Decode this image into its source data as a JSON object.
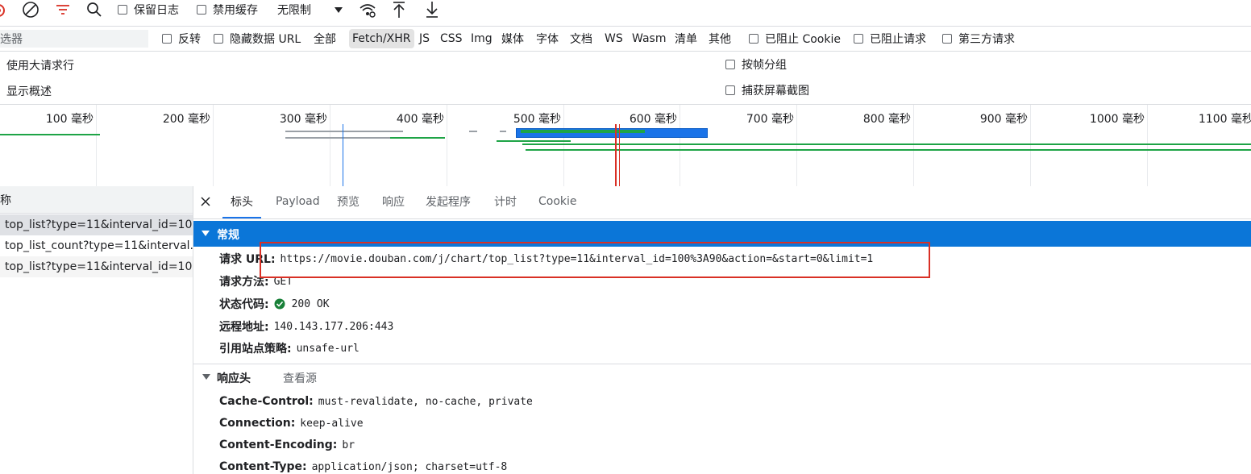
{
  "toolbar": {
    "preserve_log": "保留日志",
    "disable_cache": "禁用缓存",
    "throttle": "无限制"
  },
  "filter": {
    "placeholder": "选器",
    "invert": "反转",
    "hide_data_url": "隐藏数据 URL",
    "types": [
      "全部",
      "Fetch/XHR",
      "JS",
      "CSS",
      "Img",
      "媒体",
      "字体",
      "文档",
      "WS",
      "Wasm",
      "清单",
      "其他"
    ],
    "blocked_cookie": "已阻止 Cookie",
    "blocked_requests": "已阻止请求",
    "third_party": "第三方请求"
  },
  "options": {
    "big_rows": "使用大请求行",
    "show_overview": "显示概述",
    "group_by_frame": "按帧分组",
    "capture_screenshots": "捕获屏幕截图"
  },
  "timeline": {
    "ticks": [
      "100 毫秒",
      "200 毫秒",
      "300 毫秒",
      "400 毫秒",
      "500 毫秒",
      "600 毫秒",
      "700 毫秒",
      "800 毫秒",
      "900 毫秒",
      "1000 毫秒",
      "1100 毫秒"
    ]
  },
  "requests": {
    "header": "称",
    "items": [
      "top_list?type=11&interval_id=10...",
      "top_list_count?type=11&interval...",
      "top_list?type=11&interval_id=10..."
    ]
  },
  "tabs": [
    "标头",
    "Payload",
    "预览",
    "响应",
    "发起程序",
    "计时",
    "Cookie"
  ],
  "general": {
    "title": "常规",
    "url_key": "请求 URL:",
    "url_val": "https://movie.douban.com/j/chart/top_list?type=11&interval_id=100%3A90&action=&start=0&limit=1",
    "method_key": "请求方法:",
    "method_val": "GET",
    "status_key": "状态代码:",
    "status_val": "200 OK",
    "remote_key": "远程地址:",
    "remote_val": "140.143.177.206:443",
    "referrer_key": "引用站点策略:",
    "referrer_val": "unsafe-url"
  },
  "response_headers": {
    "title": "响应头",
    "view_source": "查看源",
    "items": [
      {
        "k": "Cache-Control:",
        "v": "must-revalidate, no-cache, private"
      },
      {
        "k": "Connection:",
        "v": "keep-alive"
      },
      {
        "k": "Content-Encoding:",
        "v": "br"
      },
      {
        "k": "Content-Type:",
        "v": "application/json; charset=utf-8"
      }
    ]
  },
  "colors": {
    "accent": "#0b76d8",
    "highlight_box": "#d93025",
    "bar_green": "#1ea446",
    "bar_gray": "#9aa0a6",
    "status_ok": "#188038"
  }
}
